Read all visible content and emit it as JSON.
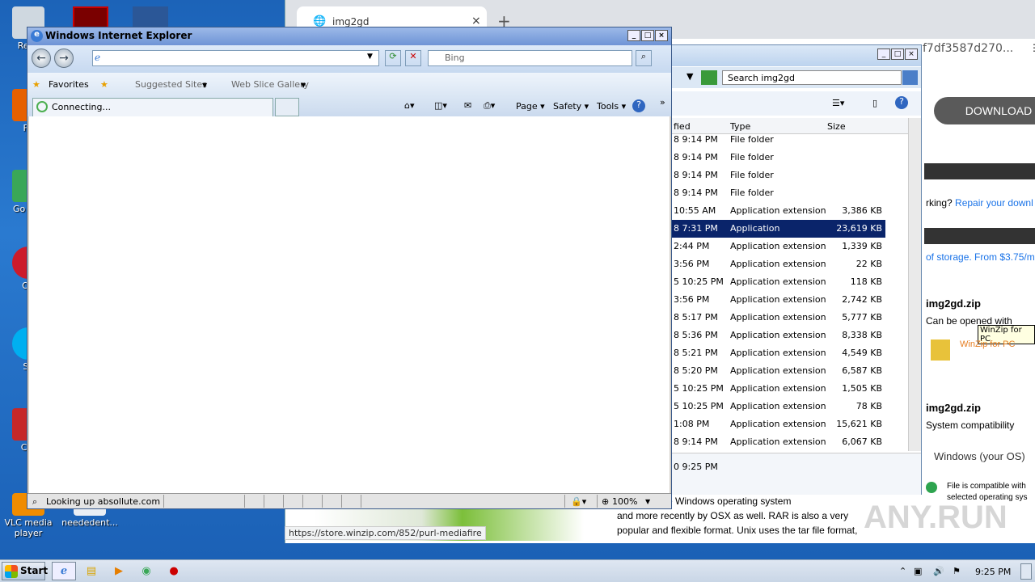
{
  "desktop": {
    "icons": [
      {
        "label": "Recy"
      },
      {
        "label": "Fir"
      },
      {
        "label": "Go Chr"
      },
      {
        "label": "Op"
      },
      {
        "label": "Sk"
      },
      {
        "label": "CCl"
      },
      {
        "label": "VLC media player"
      },
      {
        "label": "neededent..."
      }
    ]
  },
  "chrome": {
    "tab_title": "img2gd",
    "tab_close": "×",
    "new_tab": "+",
    "url_fragment": "f7df3587d270...",
    "download_label": "DOWNLOAD",
    "repair_prefix": "rking?",
    "repair_link": "Repair your downl",
    "storage_text": "of storage. From $3.75/m",
    "file1_name": "img2gd.zip",
    "file1_can_open": "Can be opened with",
    "tooltip": "WinZip for PC",
    "winzip_link": "WinZip for PC",
    "file2_name": "img2gd.zip",
    "file2_compat": "System compatibility",
    "os_label": "Windows (your OS)",
    "compat_text1": "File is compatible with",
    "compat_text2": "selected operating sys",
    "bottom_text1": ", used by the Windows operating system",
    "bottom_text2": "and more recently by OSX as well. RAR is also a very",
    "bottom_text3": "popular and flexible format. Unix uses the tar file format,",
    "link_preview": "https://store.winzip.com/852/purl-mediafire",
    "watermark": "ANY.RUN"
  },
  "explorer": {
    "search_placeholder": "Search img2gd",
    "columns": [
      "fied",
      "Type",
      "Size"
    ],
    "rows": [
      {
        "date": "8 9:14 PM",
        "type": "File folder",
        "size": ""
      },
      {
        "date": "8 9:14 PM",
        "type": "File folder",
        "size": ""
      },
      {
        "date": "8 9:14 PM",
        "type": "File folder",
        "size": ""
      },
      {
        "date": "8 9:14 PM",
        "type": "File folder",
        "size": ""
      },
      {
        "date": "10:55 AM",
        "type": "Application extension",
        "size": "3,386 KB"
      },
      {
        "date": "8 7:31 PM",
        "type": "Application",
        "size": "23,619 KB"
      },
      {
        "date": "2:44 PM",
        "type": "Application extension",
        "size": "1,339 KB"
      },
      {
        "date": "3:56 PM",
        "type": "Application extension",
        "size": "22 KB"
      },
      {
        "date": "5 10:25 PM",
        "type": "Application extension",
        "size": "118 KB"
      },
      {
        "date": "3:56 PM",
        "type": "Application extension",
        "size": "2,742 KB"
      },
      {
        "date": "8 5:17 PM",
        "type": "Application extension",
        "size": "5,777 KB"
      },
      {
        "date": "8 5:36 PM",
        "type": "Application extension",
        "size": "8,338 KB"
      },
      {
        "date": "8 5:21 PM",
        "type": "Application extension",
        "size": "4,549 KB"
      },
      {
        "date": "8 5:20 PM",
        "type": "Application extension",
        "size": "6,587 KB"
      },
      {
        "date": "5 10:25 PM",
        "type": "Application extension",
        "size": "1,505 KB"
      },
      {
        "date": "5 10:25 PM",
        "type": "Application extension",
        "size": "78 KB"
      },
      {
        "date": "1:08 PM",
        "type": "Application extension",
        "size": "15,621 KB"
      },
      {
        "date": "8 9:14 PM",
        "type": "Application extension",
        "size": "6,067 KB"
      }
    ],
    "detail_date": "0 9:25 PM"
  },
  "ie": {
    "title": "Windows Internet Explorer",
    "search_placeholder": "Bing",
    "favorites": "Favorites",
    "suggested": "Suggested Sites",
    "webslice": "Web Slice Gallery",
    "tab_label": "Connecting...",
    "page_menu": "Page",
    "safety_menu": "Safety",
    "tools_menu": "Tools",
    "status_text": "Looking up absollute.com",
    "zoom": "100%"
  },
  "taskbar": {
    "start": "Start",
    "clock": "9:25 PM"
  }
}
